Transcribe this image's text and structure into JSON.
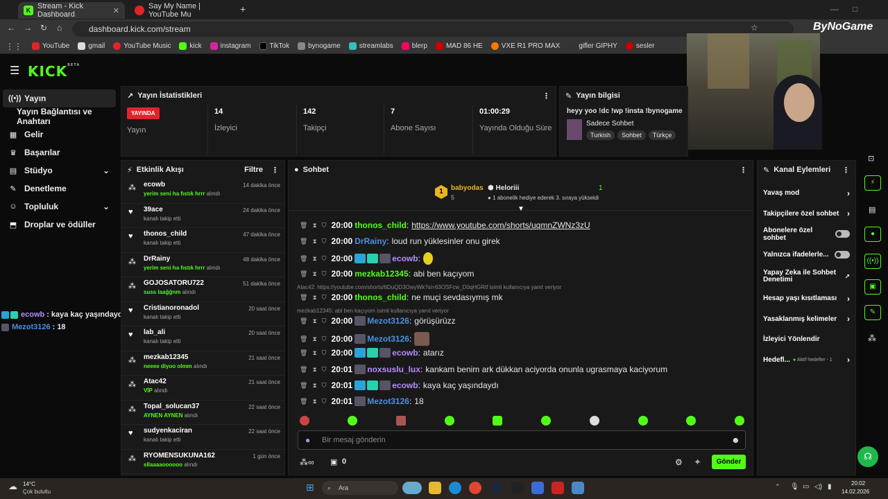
{
  "browser": {
    "tabs": [
      {
        "title": "Stream - Kick Dashboard"
      },
      {
        "title": "Say My Name | YouTube Mu"
      }
    ],
    "url": "dashboard.kick.com/stream",
    "bookmarks": [
      "YouTube",
      "gmail",
      "YouTube Music",
      "kick",
      "instagram",
      "TikTok",
      "bynogame",
      "streamlabs",
      "blerp",
      "MAD 86 HE",
      "VXE R1 PRO MAX",
      "gifler GIPHY",
      "sesler"
    ],
    "overlay_logo": "ByNoGame"
  },
  "kick": {
    "logo": "KICK",
    "beta": "BETA"
  },
  "sidebar": {
    "items": [
      {
        "label": "Yayın",
        "icon": "broadcast-icon"
      },
      {
        "label": "Yayın Bağlantısı ve Anahtarı"
      },
      {
        "label": "Gelir",
        "icon": "revenue-icon"
      },
      {
        "label": "Başarılar",
        "icon": "trophy-icon"
      },
      {
        "label": "Stüdyo",
        "icon": "studio-icon"
      },
      {
        "label": "Denetleme",
        "icon": "wrench-icon"
      },
      {
        "label": "Topluluk",
        "icon": "community-icon"
      },
      {
        "label": "Droplar ve ödüller",
        "icon": "drops-icon"
      }
    ]
  },
  "stats": {
    "title": "Yayın İstatistikleri",
    "live_badge": "YAYINDA",
    "live_label": "Yayın",
    "items": [
      {
        "value": "14",
        "label": "İzleyici"
      },
      {
        "value": "142",
        "label": "Takipçi"
      },
      {
        "value": "7",
        "label": "Abone Sayısı"
      },
      {
        "value": "01:00:29",
        "label": "Yayında Olduğu Süre"
      }
    ]
  },
  "info": {
    "title": "Yayın bilgisi",
    "stream_title": "heyy yoo !dc !wp !insta !bynogame",
    "category": "Sadece Sohbet",
    "tags": [
      "Turkish",
      "Sohbet",
      "Türkçe"
    ]
  },
  "activity": {
    "title": "Etkinlik Akışı",
    "filter": "Filtre",
    "items": [
      {
        "name": "ecowb",
        "green": "yerim seni ha fıstık hrrr",
        "sub": "alındı",
        "time": "14 dakika önce",
        "icon": "gift-icon"
      },
      {
        "name": "39ace",
        "green": "",
        "sub": "kanalı takip etti",
        "time": "24 dakika önce",
        "icon": "heart-icon"
      },
      {
        "name": "thonos_child",
        "green": "",
        "sub": "kanalı takip etti",
        "time": "47 dakika önce",
        "icon": "heart-icon"
      },
      {
        "name": "DrRainy",
        "green": "yerim seni ha fıstık hrrr",
        "sub": "alındı",
        "time": "48 dakika önce",
        "icon": "gift-icon"
      },
      {
        "name": "GOJOSATORU722",
        "green": "suss laağğnm",
        "sub": "alındı",
        "time": "51 dakika önce",
        "icon": "gift-icon"
      },
      {
        "name": "Cristianoronadol",
        "green": "",
        "sub": "kanalı takip etti",
        "time": "20 saat önce",
        "icon": "heart-icon"
      },
      {
        "name": "lab_ali",
        "green": "",
        "sub": "kanalı takip etti",
        "time": "20 saat önce",
        "icon": "heart-icon"
      },
      {
        "name": "mezkab12345",
        "green": "neeee diyoo olmm",
        "sub": "alındı",
        "time": "21 saat önce",
        "icon": "gift-icon"
      },
      {
        "name": "Atac42",
        "green": "VİP",
        "sub": "alındı",
        "time": "21 saat önce",
        "icon": "gift-icon"
      },
      {
        "name": "Topal_solucan37",
        "green": "AYNEN AYNEN",
        "sub": "alındı",
        "time": "22 saat önce",
        "icon": "gift-icon"
      },
      {
        "name": "sudyenkaciran",
        "green": "",
        "sub": "kanalı takip etti",
        "time": "22 saat önce",
        "icon": "heart-icon"
      },
      {
        "name": "RYOMENSUKUNA162",
        "green": "sllaaaaoooooo",
        "sub": "alındı",
        "time": "1 gün önce",
        "icon": "gift-icon"
      }
    ]
  },
  "chat": {
    "title": "Sohbet",
    "pinned": {
      "rank": "1",
      "user": "babyodas",
      "count": "5",
      "target": "Heloriii",
      "target_count": "1",
      "notice": "1 abonelik hediye ederek 3. sıraya yükseldi"
    },
    "messages": [
      {
        "time": "20:00",
        "user": "thonos_child",
        "color": "#53fc18",
        "text": "https://www.youtube.com/shorts/uqmnZWNz3zU",
        "link": true
      },
      {
        "time": "20:00",
        "user": "DrRainy",
        "color": "#4a90e2",
        "text": "loud run yüklesinler onu girek"
      },
      {
        "time": "20:00",
        "user": "ecowb",
        "color": "#b48cff",
        "text": "",
        "badges": 3
      },
      {
        "time": "20:00",
        "user": "mezkab12345",
        "color": "#53fc18",
        "text": "abi ben kaçıyom"
      },
      {
        "time": "20:00",
        "user": "thonos_child",
        "color": "#53fc18",
        "text": "ne muçi sevdasıymış mk"
      },
      {
        "time": "20:00",
        "user": "Mezot3126",
        "color": "#4a90e2",
        "text": "görüşürüzz",
        "badges": 1
      },
      {
        "time": "20:00",
        "user": "Mezot3126",
        "color": "#4a90e2",
        "text": "",
        "badges": 1
      },
      {
        "time": "20:00",
        "user": "ecowb",
        "color": "#b48cff",
        "text": "atarız",
        "badges": 3
      },
      {
        "time": "20:01",
        "user": "noxsuslu_lux",
        "color": "#b48cff",
        "text": "kankam benim ark dükkan aciyorda onunla ugrasmaya kaciyorum",
        "badges": 1
      },
      {
        "time": "20:01",
        "user": "ecowb",
        "color": "#b48cff",
        "text": "kaya kaç yaşındaydı",
        "badges": 3
      },
      {
        "time": "20:01",
        "user": "Mezot3126",
        "color": "#4a90e2",
        "text": "18",
        "badges": 1
      }
    ],
    "replies": [
      "Atac42: https://youtube.com/shorts/6DuQD3OwyWk?si=63OSFcw_D0qHGRtf isimli kullanıcıya yanıt veriyor",
      "mezkab12345: abi ben kaçıyom isimli kullanıcıya yanıt veriyor"
    ],
    "placeholder": "Bir mesaj gönderin",
    "points": "0",
    "send": "Gönder"
  },
  "overlay_chat": [
    {
      "user": "ecowb",
      "text": "kaya kaç yaşındaydı"
    },
    {
      "user": "Mezot3126",
      "text": "18"
    }
  ],
  "channel_actions": {
    "title": "Kanal Eylemleri",
    "items": [
      {
        "label": "Yavaş mod",
        "control": "chevron"
      },
      {
        "label": "Takipçilere özel sohbet",
        "control": "chevron"
      },
      {
        "label": "Abonelere özel sohbet",
        "control": "toggle"
      },
      {
        "label": "Yalnızca ifadelerle...",
        "control": "toggle"
      },
      {
        "label": "Yapay Zeka ile Sohbet Denetimi",
        "control": "external"
      },
      {
        "label": "Hesap yaşı kısıtlaması",
        "control": "chevron"
      },
      {
        "label": "Yasaklanmış kelimeler",
        "control": "chevron"
      },
      {
        "label": "İzleyici Yönlendir",
        "control": "none"
      },
      {
        "label": "Hedefl...",
        "extra": "Aktif hedefler - 1",
        "control": "chevron"
      }
    ]
  },
  "taskbar": {
    "temp": "14°C",
    "weather": "Çok bulutlu",
    "search": "Ara",
    "time": "20:02",
    "date": "14.02.2026"
  },
  "colors": {
    "accent": "#53fc18",
    "live": "#e0242a"
  }
}
